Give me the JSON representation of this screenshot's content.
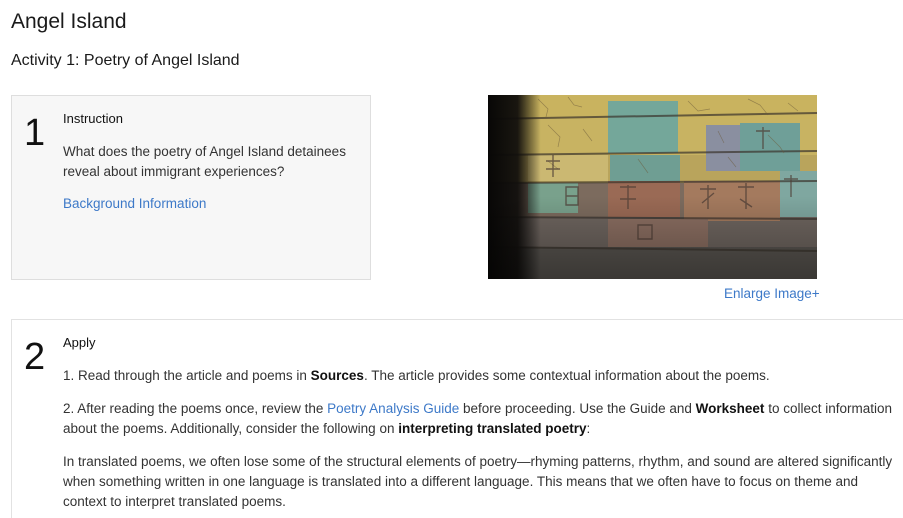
{
  "page": {
    "title": "Angel Island",
    "activity_title": "Activity 1: Poetry of Angel Island"
  },
  "step1": {
    "number": "1",
    "label": "Instruction",
    "question": "What does the poetry of Angel Island detainees reveal about immigrant experiences?",
    "link": "Background Information"
  },
  "image": {
    "enlarge": "Enlarge Image+"
  },
  "step2": {
    "number": "2",
    "label": "Apply",
    "p1": {
      "a": "1. Read through the article and poems in ",
      "b": "Sources",
      "c": ". The article provides some contextual information about the poems."
    },
    "p2": {
      "a": "2. After reading the poems once, review the ",
      "link": "Poetry Analysis Guide",
      "b": " before proceeding. Use the Guide and ",
      "c": "Worksheet",
      "d": " to collect information about the poems. Additionally, consider the following on ",
      "e": "interpreting translated poetry",
      "f": ":"
    },
    "p3": "In translated poems, we often lose some of the structural elements of poetry—rhyming patterns, rhythm, and sound are altered significantly when something written in one language is translated into a different language. This means that we often have to focus on theme and context to interpret translated poems."
  },
  "colors": {
    "link": "#3d79c8",
    "card_bg": "#f7f7f7"
  }
}
